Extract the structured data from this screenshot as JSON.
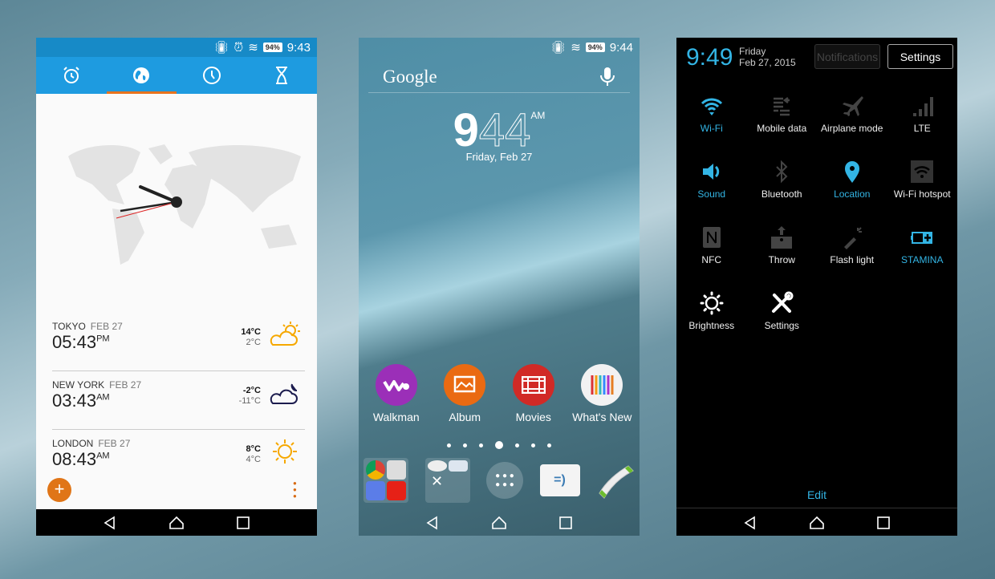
{
  "status1": {
    "battery": "94%",
    "time": "9:43"
  },
  "status2": {
    "battery": "94%",
    "time": "9:44"
  },
  "clock_app": {
    "tabs": [
      {
        "icon": "alarm-icon"
      },
      {
        "icon": "globe-icon",
        "selected": true
      },
      {
        "icon": "clock-icon"
      },
      {
        "icon": "hourglass-icon"
      }
    ],
    "cities": [
      {
        "name": "TOKYO",
        "date": "FEB 27",
        "time": "05:43",
        "ampm": "PM",
        "high": "14°C",
        "low": "2°C",
        "weather": "partly-sunny-icon"
      },
      {
        "name": "NEW YORK",
        "date": "FEB 27",
        "time": "03:43",
        "ampm": "AM",
        "high": "-2°C",
        "low": "-11°C",
        "weather": "cloudy-night-icon"
      },
      {
        "name": "LONDON",
        "date": "FEB 27",
        "time": "08:43",
        "ampm": "AM",
        "high": "8°C",
        "low": "4°C",
        "weather": "sunny-icon"
      }
    ],
    "fab": "+",
    "accent": "#1e9be0",
    "fab_color": "#e07517"
  },
  "home": {
    "search_logo": "Google",
    "clock": {
      "hour": "9",
      "minute": "44",
      "ampm": "AM",
      "date": "Friday, Feb 27"
    },
    "apps": [
      {
        "label": "Walkman",
        "color": "#9b2fb8"
      },
      {
        "label": "Album",
        "color": "#ea6a12"
      },
      {
        "label": "Movies",
        "color": "#d12a26"
      },
      {
        "label": "What's New",
        "color": "#f2f2f2"
      }
    ],
    "pages": 7,
    "current_page": 4
  },
  "quick": {
    "time": "9:49",
    "day": "Friday",
    "date": "Feb 27, 2015",
    "notifications_label": "Notifications",
    "settings_label": "Settings",
    "tiles": [
      {
        "label": "Wi-Fi",
        "icon": "wifi-icon",
        "active": true
      },
      {
        "label": "Mobile data",
        "icon": "mobile-data-icon",
        "active": false
      },
      {
        "label": "Airplane mode",
        "icon": "airplane-icon",
        "active": false
      },
      {
        "label": "LTE",
        "icon": "signal-icon",
        "active": false
      },
      {
        "label": "Sound",
        "icon": "sound-icon",
        "active": true
      },
      {
        "label": "Bluetooth",
        "icon": "bluetooth-icon",
        "active": false
      },
      {
        "label": "Location",
        "icon": "location-icon",
        "active": true
      },
      {
        "label": "Wi-Fi hotspot",
        "icon": "hotspot-icon",
        "active": false
      },
      {
        "label": "NFC",
        "icon": "nfc-icon",
        "active": false
      },
      {
        "label": "Throw",
        "icon": "throw-icon",
        "active": false
      },
      {
        "label": "Flash light",
        "icon": "flashlight-icon",
        "active": false
      },
      {
        "label": "STAMINA",
        "icon": "battery-icon",
        "active": true
      },
      {
        "label": "Brightness",
        "icon": "brightness-icon",
        "active": false
      },
      {
        "label": "Settings",
        "icon": "settings-icon",
        "active": false
      }
    ],
    "edit_label": "Edit",
    "active_color": "#33b5e5"
  }
}
